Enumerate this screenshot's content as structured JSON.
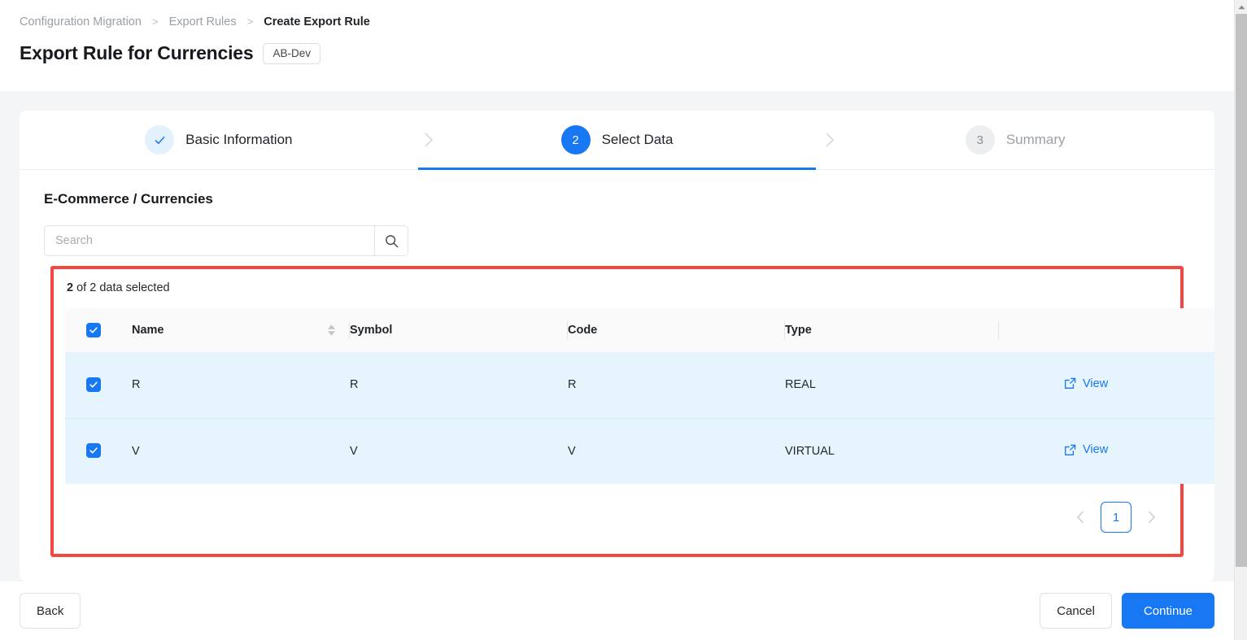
{
  "breadcrumb": {
    "items": [
      {
        "label": "Configuration Migration",
        "current": false
      },
      {
        "label": "Export Rules",
        "current": false
      },
      {
        "label": "Create Export Rule",
        "current": true
      }
    ],
    "separator": ">"
  },
  "header": {
    "title": "Export Rule for Currencies",
    "badge": "AB-Dev"
  },
  "stepper": {
    "steps": [
      {
        "indicator": "✓",
        "label": "Basic Information",
        "state": "done"
      },
      {
        "indicator": "2",
        "label": "Select Data",
        "state": "active"
      },
      {
        "indicator": "3",
        "label": "Summary",
        "state": "todo"
      }
    ]
  },
  "section": {
    "title": "E-Commerce / Currencies",
    "search": {
      "value": "",
      "placeholder": "Search",
      "icon": "search-icon"
    }
  },
  "selection": {
    "count_bold": "2",
    "count_rest": " of 2 data selected"
  },
  "table": {
    "select_all_checked": true,
    "columns": [
      {
        "key": "name",
        "label": "Name",
        "sortable": true
      },
      {
        "key": "symbol",
        "label": "Symbol",
        "sortable": false
      },
      {
        "key": "code",
        "label": "Code",
        "sortable": false
      },
      {
        "key": "type",
        "label": "Type",
        "sortable": false
      },
      {
        "key": "actions",
        "label": "",
        "sortable": false
      }
    ],
    "rows": [
      {
        "checked": true,
        "name": "R",
        "symbol": "R",
        "code": "R",
        "type": "REAL",
        "action": "View",
        "action_icon": "external-link-icon"
      },
      {
        "checked": true,
        "name": "V",
        "symbol": "V",
        "code": "V",
        "type": "VIRTUAL",
        "action": "View",
        "action_icon": "external-link-icon"
      }
    ]
  },
  "pagination": {
    "prev_icon": "chevron-left-icon",
    "next_icon": "chevron-right-icon",
    "current_page": "1"
  },
  "footer": {
    "back_label": "Back",
    "cancel_label": "Cancel",
    "continue_label": "Continue"
  },
  "colors": {
    "accent_blue": "#1877f2",
    "highlight_red": "#f4473f",
    "row_selected_bg": "#e6f4fd",
    "page_bg": "#f4f5f7"
  }
}
